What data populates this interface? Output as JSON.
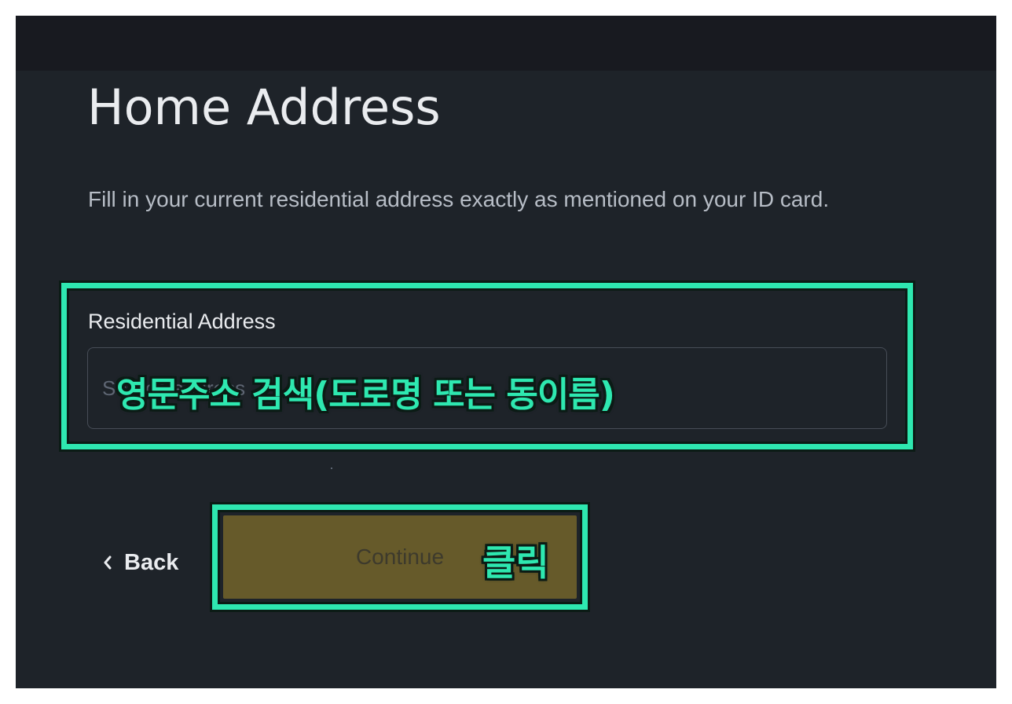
{
  "page": {
    "title": "Home Address",
    "description": "Fill in your current residential address exactly as mentioned on your ID card."
  },
  "form": {
    "address_label": "Residential Address",
    "address_value": "",
    "address_placeholder": "Search address"
  },
  "buttons": {
    "back_label": "Back",
    "continue_label": "Continue"
  },
  "annotations": {
    "search_hint": "영문주소 검색(도로명 또는 동이름)",
    "click_hint": "클릭",
    "highlight_color": "#2ee8b0"
  },
  "icons": {
    "back": "chevron-left-icon"
  },
  "colors": {
    "background": "#1e2329",
    "topbar": "#181a20",
    "text_primary": "#eaecef",
    "text_secondary": "#b7bdc6",
    "continue_disabled": "#665a2a"
  }
}
